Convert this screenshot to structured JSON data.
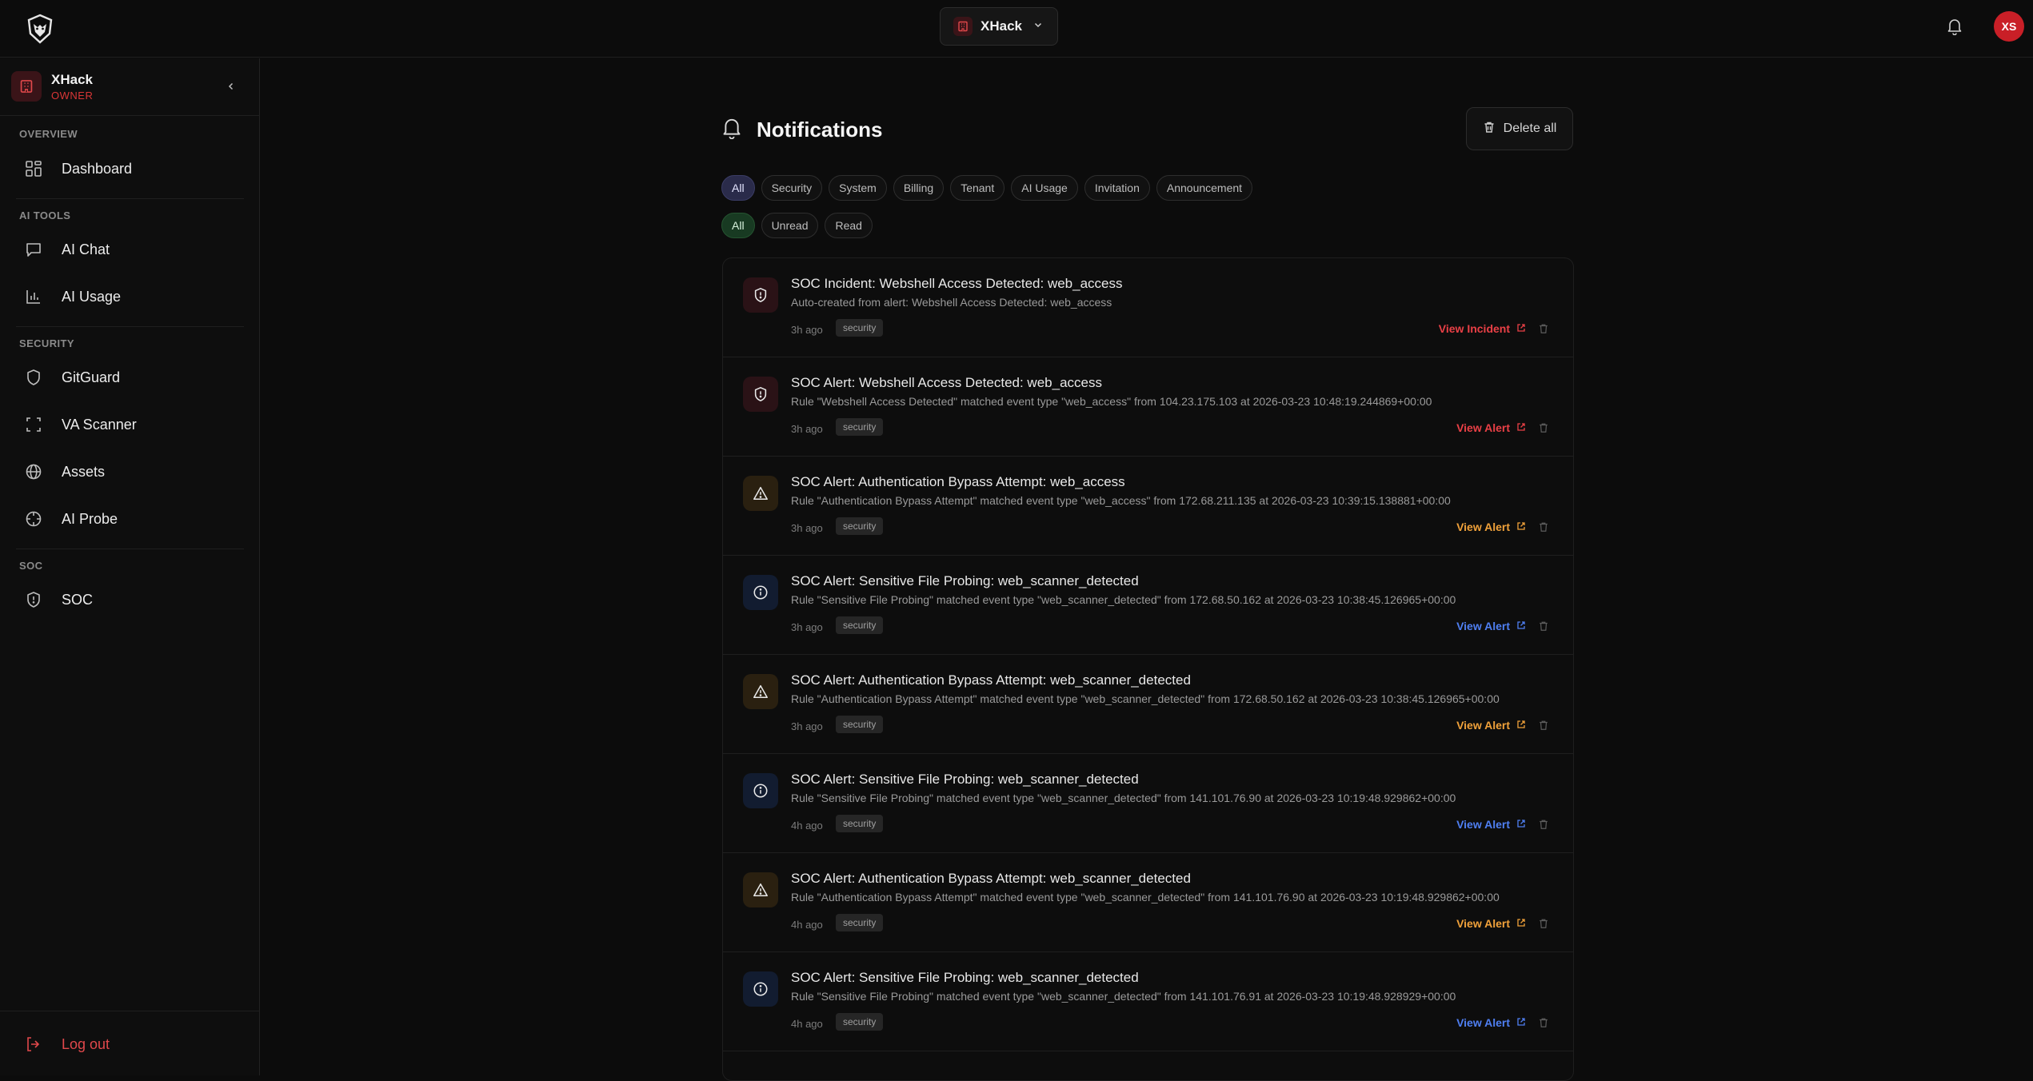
{
  "topbar": {
    "org_name": "XHack",
    "avatar_initials": "XS"
  },
  "sidebar": {
    "workspace_name": "XHack",
    "workspace_role": "OWNER",
    "sections": [
      {
        "label": "OVERVIEW",
        "items": [
          {
            "label": "Dashboard",
            "icon": "dashboard-icon"
          }
        ]
      },
      {
        "label": "AI TOOLS",
        "items": [
          {
            "label": "AI Chat",
            "icon": "chat-icon"
          },
          {
            "label": "AI Usage",
            "icon": "bar-chart-icon"
          }
        ]
      },
      {
        "label": "SECURITY",
        "items": [
          {
            "label": "GitGuard",
            "icon": "shield-icon"
          },
          {
            "label": "VA Scanner",
            "icon": "scan-icon"
          },
          {
            "label": "Assets",
            "icon": "globe-icon"
          },
          {
            "label": "AI Probe",
            "icon": "crosshair-icon"
          }
        ]
      },
      {
        "label": "SOC",
        "items": [
          {
            "label": "SOC",
            "icon": "shield-alert-icon"
          }
        ]
      }
    ],
    "logout_label": "Log out"
  },
  "main": {
    "title": "Notifications",
    "delete_all_label": "Delete all",
    "type_filters": [
      "All",
      "Security",
      "System",
      "Billing",
      "Tenant",
      "AI Usage",
      "Invitation",
      "Announcement"
    ],
    "status_filters": [
      "All",
      "Unread",
      "Read"
    ],
    "notifications": [
      {
        "title": "SOC Incident: Webshell Access Detected: web_access",
        "desc": "Auto-created from alert: Webshell Access Detected: web_access",
        "time": "3h ago",
        "tag": "security",
        "action": "View Incident",
        "severity": "red",
        "icon": "shield-alert-icon"
      },
      {
        "title": "SOC Alert: Webshell Access Detected: web_access",
        "desc": "Rule \"Webshell Access Detected\" matched event type \"web_access\" from 104.23.175.103 at 2026-03-23 10:48:19.244869+00:00",
        "time": "3h ago",
        "tag": "security",
        "action": "View Alert",
        "severity": "red",
        "icon": "shield-alert-icon"
      },
      {
        "title": "SOC Alert: Authentication Bypass Attempt: web_access",
        "desc": "Rule \"Authentication Bypass Attempt\" matched event type \"web_access\" from 172.68.211.135 at 2026-03-23 10:39:15.138881+00:00",
        "time": "3h ago",
        "tag": "security",
        "action": "View Alert",
        "severity": "amber",
        "icon": "warning-triangle-icon"
      },
      {
        "title": "SOC Alert: Sensitive File Probing: web_scanner_detected",
        "desc": "Rule \"Sensitive File Probing\" matched event type \"web_scanner_detected\" from 172.68.50.162 at 2026-03-23 10:38:45.126965+00:00",
        "time": "3h ago",
        "tag": "security",
        "action": "View Alert",
        "severity": "blue",
        "icon": "info-circle-icon"
      },
      {
        "title": "SOC Alert: Authentication Bypass Attempt: web_scanner_detected",
        "desc": "Rule \"Authentication Bypass Attempt\" matched event type \"web_scanner_detected\" from 172.68.50.162 at 2026-03-23 10:38:45.126965+00:00",
        "time": "3h ago",
        "tag": "security",
        "action": "View Alert",
        "severity": "amber",
        "icon": "warning-triangle-icon"
      },
      {
        "title": "SOC Alert: Sensitive File Probing: web_scanner_detected",
        "desc": "Rule \"Sensitive File Probing\" matched event type \"web_scanner_detected\" from 141.101.76.90 at 2026-03-23 10:19:48.929862+00:00",
        "time": "4h ago",
        "tag": "security",
        "action": "View Alert",
        "severity": "blue",
        "icon": "info-circle-icon"
      },
      {
        "title": "SOC Alert: Authentication Bypass Attempt: web_scanner_detected",
        "desc": "Rule \"Authentication Bypass Attempt\" matched event type \"web_scanner_detected\" from 141.101.76.90 at 2026-03-23 10:19:48.929862+00:00",
        "time": "4h ago",
        "tag": "security",
        "action": "View Alert",
        "severity": "amber",
        "icon": "warning-triangle-icon"
      },
      {
        "title": "SOC Alert: Sensitive File Probing: web_scanner_detected",
        "desc": "Rule \"Sensitive File Probing\" matched event type \"web_scanner_detected\" from 141.101.76.91 at 2026-03-23 10:19:48.928929+00:00",
        "time": "4h ago",
        "tag": "security",
        "action": "View Alert",
        "severity": "blue",
        "icon": "info-circle-icon"
      }
    ]
  },
  "colors": {
    "accent_red": "#e0484b",
    "alert_red": "#ea4046",
    "alert_amber": "#f0a13a",
    "alert_blue": "#4f7ff2",
    "avatar_bg": "#c91f27"
  }
}
